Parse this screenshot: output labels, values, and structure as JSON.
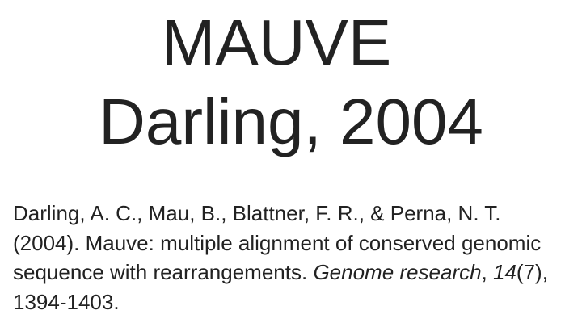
{
  "slide": {
    "title": {
      "line1": "MAUVE",
      "line2": "Darling, 2004"
    },
    "citation": {
      "authors_year": "Darling, A. C., Mau, B., Blattner, F. R., & Perna, N. T. (2004). Mauve: multiple alignment of conserved genomic sequence with rearrangements. ",
      "journal": "Genome research",
      "sep1": ", ",
      "volume": "14",
      "issue": "(7)",
      "pages": ", 1394-1403."
    }
  }
}
